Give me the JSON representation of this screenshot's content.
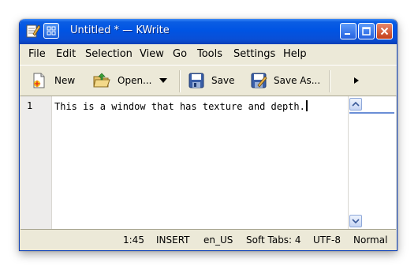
{
  "window": {
    "title": "Untitled * — KWrite"
  },
  "menu": {
    "items": [
      "File",
      "Edit",
      "Selection",
      "View",
      "Go",
      "Tools",
      "Settings",
      "Help"
    ]
  },
  "toolbar": {
    "new_label": "New",
    "open_label": "Open...",
    "save_label": "Save",
    "save_as_label": "Save As..."
  },
  "editor": {
    "line_number": "1",
    "content": "This is a window that has texture and depth."
  },
  "status": {
    "position": "1:45",
    "mode": "INSERT",
    "language": "en_US",
    "tabs": "Soft Tabs: 4",
    "encoding": "UTF-8",
    "highlight": "Normal"
  },
  "colors": {
    "titlebar": "#0054e3",
    "chrome": "#ece9d8",
    "close_button": "#c4401c"
  }
}
